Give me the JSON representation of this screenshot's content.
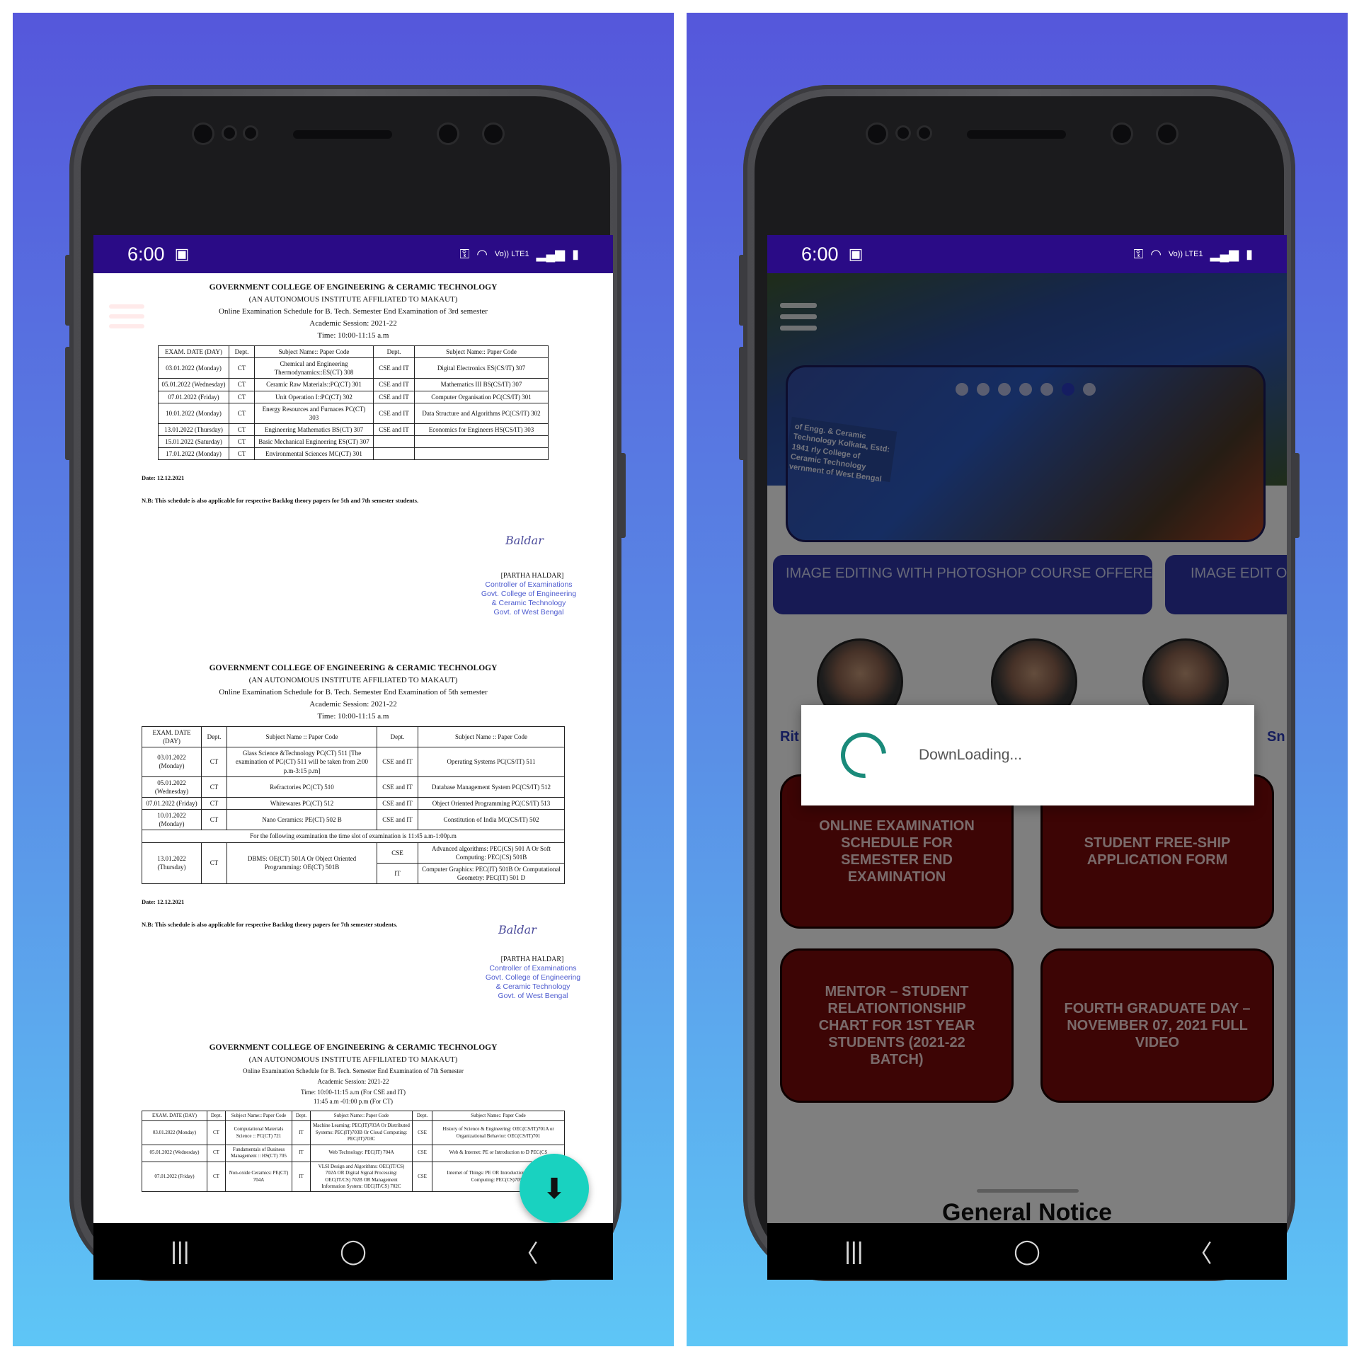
{
  "status": {
    "time": "6:00",
    "net_label": "Vo)) LTE1"
  },
  "nav": {
    "recent": "|||",
    "home": "◯",
    "back": "〈"
  },
  "left": {
    "page1": {
      "title": "GOVERNMENT COLLEGE OF ENGINEERING & CERAMIC TECHNOLOGY",
      "subtitle": "(AN AUTONOMOUS INSTITUTE AFFILIATED TO MAKAUT)",
      "line1": "Online Examination Schedule for B. Tech. Semester End Examination of 3rd semester",
      "session": "Academic Session: 2021-22",
      "time": "Time: 10:00-11:15 a.m",
      "headers": [
        "EXAM. DATE (DAY)",
        "Dept.",
        "Subject Name:: Paper Code",
        "Dept.",
        "Subject Name:: Paper Code"
      ],
      "rows": [
        [
          "03.01.2022 (Monday)",
          "CT",
          "Chemical and Engineering Thermodynamics::ES(CT) 308",
          "CSE and IT",
          "Digital Electronics ES(CS/IT) 307"
        ],
        [
          "05.01.2022 (Wednesday)",
          "CT",
          "Ceramic Raw Materials::PC(CT) 301",
          "CSE and IT",
          "Mathematics III BS(CS/IT) 307"
        ],
        [
          "07.01.2022 (Friday)",
          "CT",
          "Unit Operation I::PC(CT) 302",
          "CSE and IT",
          "Computer Organisation PC(CS/IT) 301"
        ],
        [
          "10.01.2022 (Monday)",
          "CT",
          "Energy Resources and Furnaces PC(CT) 303",
          "CSE and IT",
          "Data Structure and Algorithms PC(CS/IT) 302"
        ],
        [
          "13.01.2022 (Thursday)",
          "CT",
          "Engineering Mathematics BS(CT) 307",
          "CSE and IT",
          "Economics for Engineers HS(CS/IT) 303"
        ],
        [
          "15.01.2022 (Saturday)",
          "CT",
          "Basic Mechanical Engineering ES(CT) 307",
          "",
          ""
        ],
        [
          "17.01.2022 (Monday)",
          "CT",
          "Environmental Sciences MC(CT) 301",
          "",
          ""
        ]
      ],
      "date": "Date: 12.12.2021",
      "note": "N.B: This schedule is also applicable for respective Backlog theory papers for 5th and 7th semester students.",
      "signer": "[PARTHA HALDAR]",
      "signature": "Baldar",
      "stamp": [
        "Controller of Examinations",
        "Govt. College of Engineering",
        "& Ceramic Technology",
        "Govt. of West Bengal"
      ]
    },
    "page2": {
      "title": "GOVERNMENT COLLEGE OF ENGINEERING & CERAMIC TECHNOLOGY",
      "subtitle": "(AN AUTONOMOUS INSTITUTE AFFILIATED TO MAKAUT)",
      "line1": "Online Examination Schedule for B. Tech. Semester End Examination of 5th semester",
      "session": "Academic Session: 2021-22",
      "time": "Time: 10:00-11:15 a.m",
      "headers": [
        "EXAM. DATE (DAY)",
        "Dept.",
        "Subject Name :: Paper Code",
        "Dept.",
        "Subject Name :: Paper Code"
      ],
      "rows": [
        [
          "03.01.2022 (Monday)",
          "CT",
          "Glass Science &Technology PC(CT) 511 [The examination of PC(CT) 511 will be taken from 2:00 p.m-3:15 p.m]",
          "CSE and IT",
          "Operating Systems PC(CS/IT) 511"
        ],
        [
          "05.01.2022 (Wednesday)",
          "CT",
          "Refractories PC(CT) 510",
          "CSE and IT",
          "Database Management System PC(CS/IT) 512"
        ],
        [
          "07.01.2022 (Friday)",
          "CT",
          "Whitewares PC(CT) 512",
          "CSE and IT",
          "Object Oriented Programming PC(CS/IT) 513"
        ],
        [
          "10.01.2022 (Monday)",
          "CT",
          "Nano Ceramics: PE(CT) 502 B",
          "CSE and IT",
          "Constitution of India MC(CS/IT) 502"
        ]
      ],
      "span_note": "For the following examination the time slot of examination is 11:45 a.m-1:00p.m",
      "last": {
        "date": "13.01.2022 (Thursday)",
        "dept": "CT",
        "subject": "DBMS: OE(CT) 501A Or Object Oriented Programming: OE(CT) 501B",
        "cse": "CSE",
        "cse_subject": "Advanced algorithms: PEC(CS) 501 A Or Soft Computing: PEC(CS) 501B",
        "it": "IT",
        "it_subject": "Computer Graphics: PEC(IT) 501B Or Computational Geometry: PEC(IT) 501 D"
      },
      "date": "Date: 12.12.2021",
      "note": "N.B: This schedule is also applicable for respective Backlog theory papers for 7th semester students.",
      "signer": "[PARTHA HALDAR]",
      "signature": "Baldar",
      "stamp": [
        "Controller of Examinations",
        "Govt. College of Engineering",
        "& Ceramic Technology",
        "Govt. of West Bengal"
      ]
    },
    "page3": {
      "title": "GOVERNMENT COLLEGE OF ENGINEERING & CERAMIC TECHNOLOGY",
      "subtitle": "(AN AUTONOMOUS INSTITUTE AFFILIATED TO MAKAUT)",
      "line1": "Online Examination Schedule for B. Tech. Semester End Examination of 7th Semester",
      "session": "Academic Session: 2021-22",
      "time": "Time: 10:00-11:15 a.m (For CSE and IT)",
      "time2": "11:45 a.m -01:00 p.m (For CT)",
      "headers": [
        "EXAM. DATE (DAY)",
        "Dept.",
        "Subject Name:: Paper Code",
        "Dept.",
        "Subject Name:: Paper Code",
        "Dept.",
        "Subject Name:: Paper Code"
      ],
      "rows": [
        [
          "03.01.2022 (Monday)",
          "CT",
          "Computational Materials Science :: PC(CT) 721",
          "IT",
          "Machine Learning: PEC(IT)703A Or Distributed Systems: PEC(IT)703B Or Cloud Computing: PEC(IT)703C",
          "CSE",
          "History of Science & Engineering: OEC(CS/IT)701A or Organizational Behavior: OEC(CS/IT)701"
        ],
        [
          "05.01.2022 (Wednesday)",
          "CT",
          "Fundamentals of Business Management :: HS(CT) 705",
          "IT",
          "Web Technology: PEC(IT) 704A",
          "CSE",
          "Web & Internet: PE or Introduction to D PEC(CS"
        ],
        [
          "07.01.2022 (Friday)",
          "CT",
          "Non-oxide Ceramics: PE(CT) 704A",
          "IT",
          "VLSI Design and Algorithms: OEC(IT/CS) 702A OR Digital Signal Processing: OEC(IT/CS) 702B OR Management Information System: OEC(IT/CS) 702C",
          "CSE",
          "Internet of Things: PE OR Introduction to Quantum Computing: PEC(CS)705D"
        ]
      ]
    },
    "fab_icon": "download-icon"
  },
  "right": {
    "banner_sign": "of Engg. & Ceramic Technology Kolkata, Estd: 1941 rly College of Ceramic Technology vernment of West Bengal",
    "slider_dots": 7,
    "slider_active_dot": 5,
    "tickers": [
      "IMAGE EDITING WITH PHOTOSHOP COURSE OFFERED BY DEPT. OF IT, GCECT (COURSE DET...",
      "IMAGE EDIT OFFERED BY D"
    ],
    "people": [
      "Rit",
      "Sn"
    ],
    "tiles": [
      "ONLINE EXAMINATION SCHEDULE FOR SEMESTER END EXAMINATION",
      "STUDENT FREE-SHIP APPLICATION FORM",
      "MENTOR – STUDENT RELATIONTIONSHIP CHART FOR 1ST YEAR STUDENTS (2021-22 BATCH)",
      "FOURTH GRADUATE DAY – NOVEMBER 07, 2021 FULL VIDEO"
    ],
    "dialog_text": "DownLoading...",
    "sheet_title": "General Notice"
  },
  "colors": {
    "status_bar": "#2a0b86",
    "fab": "#19d2c0",
    "tile": "#7a0b0b",
    "ticker": "#2f35a8"
  }
}
